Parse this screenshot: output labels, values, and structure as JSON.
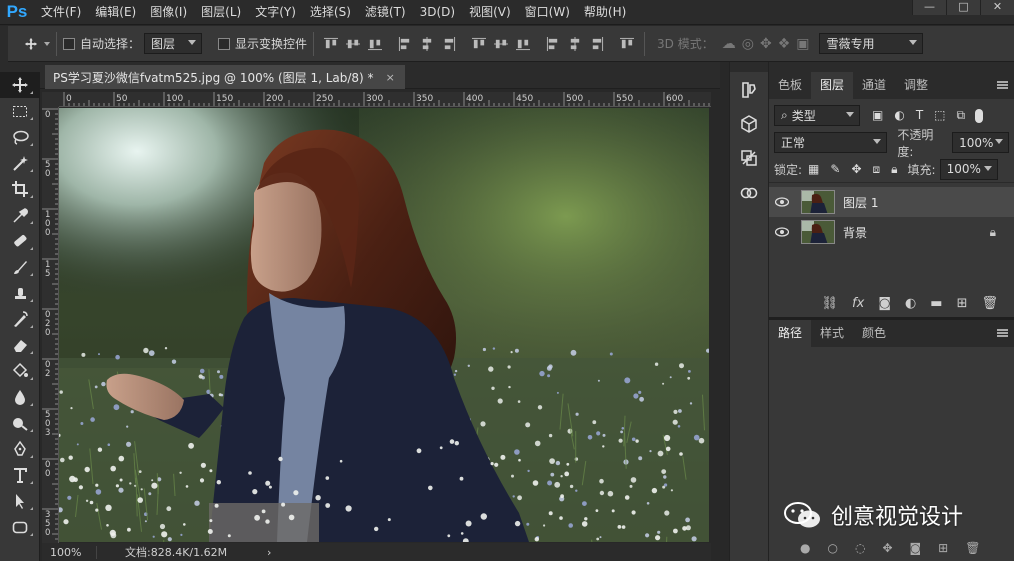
{
  "app": {
    "logo": "Ps"
  },
  "menu": [
    "文件(F)",
    "编辑(E)",
    "图像(I)",
    "图层(L)",
    "文字(Y)",
    "选择(S)",
    "滤镜(T)",
    "3D(D)",
    "视图(V)",
    "窗口(W)",
    "帮助(H)"
  ],
  "window_controls": {
    "minimize": "—",
    "maximize": "□",
    "close": "✕"
  },
  "options": {
    "auto_select_label": "自动选择：",
    "auto_select_value": "图层",
    "show_transform_label": "显示变换控件",
    "mode_3d_label": "3D 模式：",
    "workspace": "雪薇专用"
  },
  "document": {
    "tab_title": "PS学习夏沙微信fvatm525.jpg @ 100% (图层 1, Lab/8) *",
    "tab_close": "×",
    "ruler_top_labels": [
      "0",
      "50",
      "100",
      "150",
      "200",
      "250",
      "300",
      "350",
      "400",
      "450",
      "500",
      "550",
      "600"
    ],
    "ruler_left_labels": [
      "0",
      "5",
      "0",
      "1",
      "0",
      "0",
      "1",
      "5",
      "0",
      "2",
      "0",
      "0",
      "2",
      "5",
      "0",
      "3",
      "0",
      "0",
      "3",
      "5",
      "0",
      "4",
      "0",
      "0"
    ]
  },
  "status": {
    "zoom": "100%",
    "doc_size": "文档:828.4K/1.62M",
    "arrow": "›"
  },
  "panels": {
    "top_tabs": [
      "色板",
      "图层",
      "通道",
      "调整"
    ],
    "active_top_tab": "图层",
    "filter_kind": "类型",
    "blend_mode": "正常",
    "opacity_label": "不透明度:",
    "opacity_value": "100%",
    "lock_label": "锁定:",
    "fill_label": "填充:",
    "fill_value": "100%",
    "layers": [
      {
        "name": "图层 1",
        "selected": true,
        "locked": false
      },
      {
        "name": "背景",
        "selected": false,
        "locked": true
      }
    ],
    "footer_fx": "fx",
    "bottom_tabs": [
      "路径",
      "样式",
      "颜色"
    ],
    "active_bottom_tab": "路径"
  },
  "watermark": "创意视觉设计",
  "colors": {
    "accent": "#31a8ff",
    "panel": "#383838",
    "dark": "#2b2b2b"
  }
}
